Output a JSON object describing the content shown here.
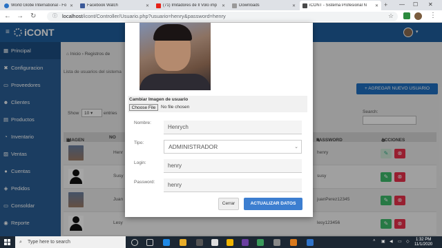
{
  "browser": {
    "tabs": [
      {
        "label": "World Globe International - Fo",
        "color": "#2a72c4"
      },
      {
        "label": "Facebook Watch",
        "color": "#3b5998"
      },
      {
        "label": "(71) Imitadores de Il Volo imp",
        "color": "#e62117"
      },
      {
        "label": "Downloads",
        "color": "#999999"
      },
      {
        "label": "iCONT - Sistema Profesional N",
        "color": "#4a4a4a"
      }
    ],
    "new_tab": "+",
    "url_host": "localhost",
    "url_path": "/icont/Controller/Usuario.php?usuario=henry&password=henry",
    "win_min": "—",
    "win_max": "☐",
    "win_close": "✕"
  },
  "app": {
    "brand": "iCONT",
    "brand_color": "#1f5e9d"
  },
  "sidebar": {
    "items": [
      {
        "label": "Principal",
        "icon": "▦"
      },
      {
        "label": "Configuracion",
        "icon": "✖"
      },
      {
        "label": "Proveedores",
        "icon": "▭"
      },
      {
        "label": "Clientes",
        "icon": "☻"
      },
      {
        "label": "Productos",
        "icon": "▤"
      },
      {
        "label": "Inventario",
        "icon": "◔"
      },
      {
        "label": "Ventas",
        "icon": "▨"
      },
      {
        "label": "Cuentas",
        "icon": "●"
      },
      {
        "label": "Pedidos",
        "icon": "◈"
      },
      {
        "label": "Consoldar",
        "icon": "▭"
      },
      {
        "label": "Reporte",
        "icon": "◉"
      }
    ]
  },
  "main": {
    "breadcrumb_home": "Inicio",
    "breadcrumb_current": "Registros de",
    "subtitle": "Lista de usuarios del sistema",
    "add_button": "AGREGAR NUEVO USUARIO",
    "show_label": "Show",
    "show_value": "10",
    "entries_label": "entries",
    "search_label": "Search:",
    "columns": {
      "image": "IMAGEN",
      "name": "NO",
      "password": "PASSWORD",
      "actions": "ACCIONES"
    },
    "rows": [
      {
        "name": "Henr",
        "password": "henry",
        "photo": true
      },
      {
        "name": "Susy",
        "password": "susy",
        "photo": false
      },
      {
        "name": "Juan",
        "password": "juanPerez12345",
        "photo": true
      },
      {
        "name": "Lesy",
        "password": "lesy123456",
        "photo": false
      }
    ]
  },
  "modal": {
    "file_label": "Cambiar Imagen de usuario",
    "file_button": "Choose File",
    "file_status": "No file chosen",
    "fields": {
      "nombre_label": "Nombre:",
      "nombre_value": "Henrych",
      "tipo_label": "Tipo:",
      "tipo_value": "ADMINISTRADOR",
      "login_label": "Login:",
      "login_value": "henry",
      "password_label": "Password:",
      "password_value": "henry"
    },
    "cancel_button": "Cerrar",
    "update_button": "ACTUALIZAR DATOS"
  },
  "taskbar": {
    "search_placeholder": "Type here to search",
    "time": "1:32 PM",
    "date": "11/1/2020"
  }
}
